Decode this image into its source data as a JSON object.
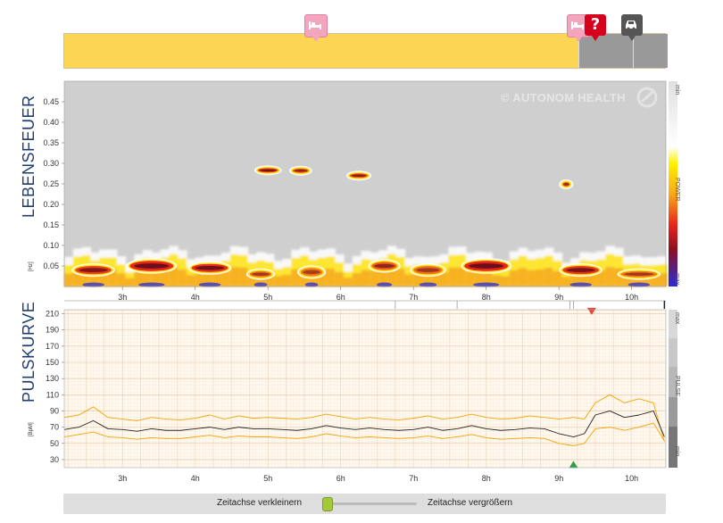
{
  "colors": {
    "timeline_yellow": "#fcd554",
    "timeline_gray": "#999999",
    "title_blue": "#1f3d73",
    "pulse_orange": "#f4a300",
    "pulse_black": "#222222",
    "down_arrow_red": "#e8453c",
    "up_arrow_green": "#2ea043"
  },
  "icons": [
    "bed-icon",
    "question-icon",
    "car-icon",
    "autonom-health-logo-icon"
  ],
  "timeline": {
    "markers": [
      {
        "type": "bed",
        "time_h": 5.65
      },
      {
        "type": "bed",
        "time_h": 9.25
      },
      {
        "type": "question",
        "time_h": 9.5
      },
      {
        "type": "car",
        "time_h": 10.0
      }
    ],
    "gray_from_h": 9.25
  },
  "watermark": "© AUTONOM HEALTH",
  "lebensfeuer": {
    "title": "LEBENSFEUER",
    "unit": "[Hz]",
    "scale_top": "min",
    "scale_mid": "POWER",
    "scale_bottom": "max"
  },
  "pulskurve": {
    "title": "PULSKURVE",
    "unit": "[BpM]",
    "scale_top": "max",
    "scale_mid": "PULSE",
    "scale_bottom": "min"
  },
  "chart_data": [
    {
      "type": "heatmap",
      "title": "LEBENSFEUER",
      "xlabel": "",
      "ylabel": "[Hz]",
      "x_ticks": [
        "3h",
        "4h",
        "5h",
        "6h",
        "7h",
        "8h",
        "9h",
        "10h"
      ],
      "x_range_h": [
        2.2,
        10.47
      ],
      "y_ticks": [
        0.05,
        0.1,
        0.15,
        0.2,
        0.25,
        0.3,
        0.35,
        0.4,
        0.45
      ],
      "y_tick_labels": [
        "0.05",
        "0.10",
        "0.15",
        "0.20",
        "0.25",
        "0.30",
        "0.35",
        "0.40",
        "0.45"
      ],
      "ylim": [
        0,
        0.5
      ],
      "colorbar": [
        "min",
        "POWER",
        "max"
      ],
      "hotspots": [
        {
          "t": 5.0,
          "f": 0.283,
          "w": 0.28,
          "h": 0.006,
          "p": 0.9
        },
        {
          "t": 5.45,
          "f": 0.282,
          "w": 0.22,
          "h": 0.006,
          "p": 0.75
        },
        {
          "t": 6.25,
          "f": 0.27,
          "w": 0.25,
          "h": 0.007,
          "p": 0.8
        },
        {
          "t": 9.1,
          "f": 0.249,
          "w": 0.1,
          "h": 0.004,
          "p": 0.7
        },
        {
          "t": 2.6,
          "f": 0.04,
          "w": 0.5,
          "h": 0.02,
          "p": 0.85
        },
        {
          "t": 3.4,
          "f": 0.05,
          "w": 0.6,
          "h": 0.025,
          "p": 1.0
        },
        {
          "t": 4.2,
          "f": 0.045,
          "w": 0.5,
          "h": 0.02,
          "p": 0.95
        },
        {
          "t": 4.9,
          "f": 0.03,
          "w": 0.3,
          "h": 0.015,
          "p": 0.6
        },
        {
          "t": 5.6,
          "f": 0.035,
          "w": 0.3,
          "h": 0.02,
          "p": 0.55
        },
        {
          "t": 6.6,
          "f": 0.05,
          "w": 0.35,
          "h": 0.02,
          "p": 0.7
        },
        {
          "t": 7.2,
          "f": 0.04,
          "w": 0.4,
          "h": 0.02,
          "p": 0.6
        },
        {
          "t": 8.0,
          "f": 0.05,
          "w": 0.6,
          "h": 0.025,
          "p": 1.0
        },
        {
          "t": 9.3,
          "f": 0.04,
          "w": 0.5,
          "h": 0.02,
          "p": 0.9
        },
        {
          "t": 10.1,
          "f": 0.03,
          "w": 0.5,
          "h": 0.015,
          "p": 0.6
        }
      ]
    },
    {
      "type": "line",
      "title": "PULSKURVE",
      "xlabel": "",
      "ylabel": "[BpM]",
      "x_ticks": [
        "3h",
        "4h",
        "5h",
        "6h",
        "7h",
        "8h",
        "9h",
        "10h"
      ],
      "x_range_h": [
        2.2,
        10.47
      ],
      "y_ticks": [
        30,
        50,
        70,
        90,
        110,
        130,
        150,
        170,
        190,
        210
      ],
      "y_tick_labels": [
        "30",
        "50",
        "70",
        "90",
        "110",
        "130",
        "150",
        "170",
        "190",
        "210"
      ],
      "ylim": [
        20,
        215
      ],
      "x": [
        2.2,
        2.4,
        2.6,
        2.8,
        3.0,
        3.2,
        3.4,
        3.6,
        3.8,
        4.0,
        4.2,
        4.4,
        4.6,
        4.8,
        5.0,
        5.2,
        5.4,
        5.6,
        5.8,
        6.0,
        6.2,
        6.4,
        6.6,
        6.8,
        7.0,
        7.2,
        7.4,
        7.6,
        7.8,
        8.0,
        8.2,
        8.4,
        8.6,
        8.8,
        9.0,
        9.2,
        9.35,
        9.5,
        9.7,
        9.9,
        10.1,
        10.3,
        10.45
      ],
      "series": [
        {
          "values": [
            82,
            85,
            95,
            82,
            80,
            78,
            82,
            80,
            79,
            81,
            85,
            80,
            84,
            81,
            82,
            81,
            80,
            82,
            86,
            83,
            80,
            82,
            80,
            79,
            81,
            84,
            80,
            82,
            86,
            82,
            80,
            81,
            84,
            82,
            80,
            82,
            80,
            100,
            110,
            100,
            105,
            100,
            52
          ]
        },
        {
          "values": [
            67,
            70,
            78,
            68,
            67,
            65,
            68,
            66,
            66,
            68,
            70,
            67,
            70,
            68,
            68,
            67,
            66,
            68,
            72,
            69,
            67,
            69,
            67,
            66,
            67,
            70,
            66,
            68,
            72,
            68,
            66,
            67,
            69,
            68,
            62,
            58,
            62,
            85,
            90,
            82,
            85,
            90,
            58
          ]
        },
        {
          "values": [
            58,
            61,
            64,
            58,
            57,
            55,
            57,
            56,
            56,
            58,
            60,
            57,
            59,
            58,
            58,
            57,
            56,
            58,
            62,
            59,
            57,
            58,
            57,
            56,
            57,
            59,
            56,
            58,
            61,
            57,
            55,
            56,
            57,
            56,
            50,
            47,
            50,
            68,
            70,
            66,
            70,
            75,
            53
          ]
        }
      ],
      "markers": [
        {
          "type": "max-down-arrow",
          "x": 9.45,
          "y": 213
        },
        {
          "type": "min-up-arrow",
          "x": 9.2,
          "y": 24
        }
      ]
    }
  ],
  "controls": {
    "zoom_out_label": "Zeitachse verkleinern",
    "zoom_in_label": "Zeitachse vergrößern",
    "zoom_level": 0.05
  }
}
